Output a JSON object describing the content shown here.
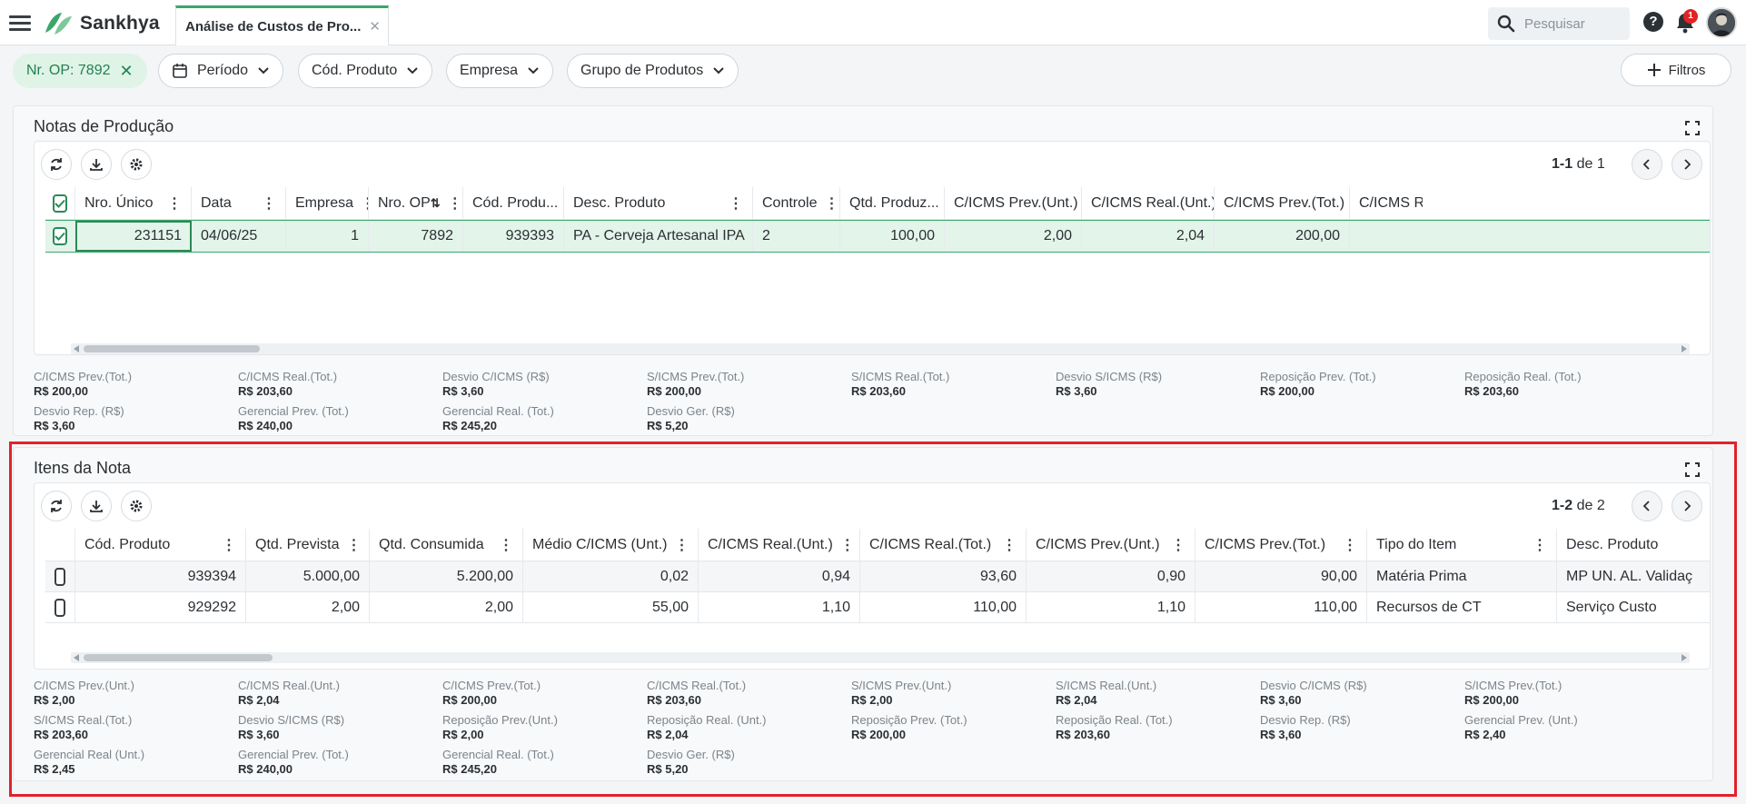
{
  "header": {
    "brand": "Sankhya",
    "tab_label": "Análise de Custos de Pro...",
    "search_placeholder": "Pesquisar",
    "help_label": "?",
    "notifications_count": "1"
  },
  "filters": {
    "active_chip": "Nr. OP: 7892",
    "chips": [
      "Período",
      "Cód. Produto",
      "Empresa",
      "Grupo de Produtos"
    ],
    "filtros_button": "Filtros"
  },
  "notas": {
    "title": "Notas de Produção",
    "pager_range": "1-1",
    "pager_of": "de 1",
    "columns": [
      "Nro. Único",
      "Data",
      "Empresa",
      "Nro. OP",
      "Cód. Produ...",
      "Desc. Produto",
      "Controle",
      "Qtd. Produz...",
      "C/ICMS Prev.(Unt.)",
      "C/ICMS Real.(Unt.)",
      "C/ICMS Prev.(Tot.)",
      "C/ICMS Rea"
    ],
    "rows": [
      [
        "231151",
        "04/06/25",
        "1",
        "7892",
        "939393",
        "PA - Cerveja Artesanal IPA",
        "2",
        "100,00",
        "2,00",
        "2,04",
        "200,00",
        ""
      ]
    ],
    "summary": [
      {
        "label": "C/ICMS Prev.(Tot.)",
        "value": "R$ 200,00"
      },
      {
        "label": "C/ICMS Real.(Tot.)",
        "value": "R$ 203,60"
      },
      {
        "label": "Desvio C/ICMS (R$)",
        "value": "R$ 3,60"
      },
      {
        "label": "S/ICMS Prev.(Tot.)",
        "value": "R$ 200,00"
      },
      {
        "label": "S/ICMS Real.(Tot.)",
        "value": "R$ 203,60"
      },
      {
        "label": "Desvio S/ICMS (R$)",
        "value": "R$ 3,60"
      },
      {
        "label": "Reposição Prev. (Tot.)",
        "value": "R$ 200,00"
      },
      {
        "label": "Reposição Real. (Tot.)",
        "value": "R$ 203,60"
      },
      {
        "label": "Desvio Rep. (R$)",
        "value": "R$ 3,60"
      },
      {
        "label": "Gerencial Prev. (Tot.)",
        "value": "R$ 240,00"
      },
      {
        "label": "Gerencial Real. (Tot.)",
        "value": "R$ 245,20"
      },
      {
        "label": "Desvio Ger. (R$)",
        "value": "R$ 5,20"
      }
    ]
  },
  "itens": {
    "title": "Itens da Nota",
    "pager_range": "1-2",
    "pager_of": "de 2",
    "columns": [
      "Cód. Produto",
      "Qtd. Prevista",
      "Qtd. Consumida",
      "Médio C/ICMS (Unt.)",
      "C/ICMS Real.(Unt.)",
      "C/ICMS Real.(Tot.)",
      "C/ICMS Prev.(Unt.)",
      "C/ICMS Prev.(Tot.)",
      "Tipo do Item",
      "Desc. Produto"
    ],
    "rows": [
      [
        "939394",
        "5.000,00",
        "5.200,00",
        "0,02",
        "0,94",
        "93,60",
        "0,90",
        "90,00",
        "Matéria Prima",
        "MP UN. AL. Validaç"
      ],
      [
        "929292",
        "2,00",
        "2,00",
        "55,00",
        "1,10",
        "110,00",
        "1,10",
        "110,00",
        "Recursos de CT",
        "Serviço Custo"
      ]
    ],
    "summary": [
      {
        "label": "C/ICMS Prev.(Unt.)",
        "value": "R$ 2,00"
      },
      {
        "label": "C/ICMS Real.(Unt.)",
        "value": "R$ 2,04"
      },
      {
        "label": "C/ICMS Prev.(Tot.)",
        "value": "R$ 200,00"
      },
      {
        "label": "C/ICMS Real.(Tot.)",
        "value": "R$ 203,60"
      },
      {
        "label": "S/ICMS Prev.(Unt.)",
        "value": "R$ 2,00"
      },
      {
        "label": "S/ICMS Real.(Unt.)",
        "value": "R$ 2,04"
      },
      {
        "label": "Desvio C/ICMS (R$)",
        "value": "R$ 3,60"
      },
      {
        "label": "S/ICMS Prev.(Tot.)",
        "value": "R$ 200,00"
      },
      {
        "label": "S/ICMS Real.(Tot.)",
        "value": "R$ 203,60"
      },
      {
        "label": "Desvio S/ICMS (R$)",
        "value": "R$ 3,60"
      },
      {
        "label": "Reposição Prev.(Unt.)",
        "value": "R$ 2,00"
      },
      {
        "label": "Reposição Real. (Unt.)",
        "value": "R$ 2,04"
      },
      {
        "label": "Reposição Prev. (Tot.)",
        "value": "R$ 200,00"
      },
      {
        "label": "Reposição Real. (Tot.)",
        "value": "R$ 203,60"
      },
      {
        "label": "Desvio Rep. (R$)",
        "value": "R$ 3,60"
      },
      {
        "label": "Gerencial Prev. (Unt.)",
        "value": "R$ 2,40"
      },
      {
        "label": "Gerencial Real (Unt.)",
        "value": "R$ 2,45"
      },
      {
        "label": "Gerencial Prev. (Tot.)",
        "value": "R$ 240,00"
      },
      {
        "label": "Gerencial Real. (Tot.)",
        "value": "R$ 245,20"
      },
      {
        "label": "Desvio Ger. (R$)",
        "value": "R$ 5,20"
      }
    ]
  },
  "colors": {
    "brand_green": "#3aa66b",
    "selection_green": "#e3f4ea",
    "highlight_red": "#e2222b"
  }
}
